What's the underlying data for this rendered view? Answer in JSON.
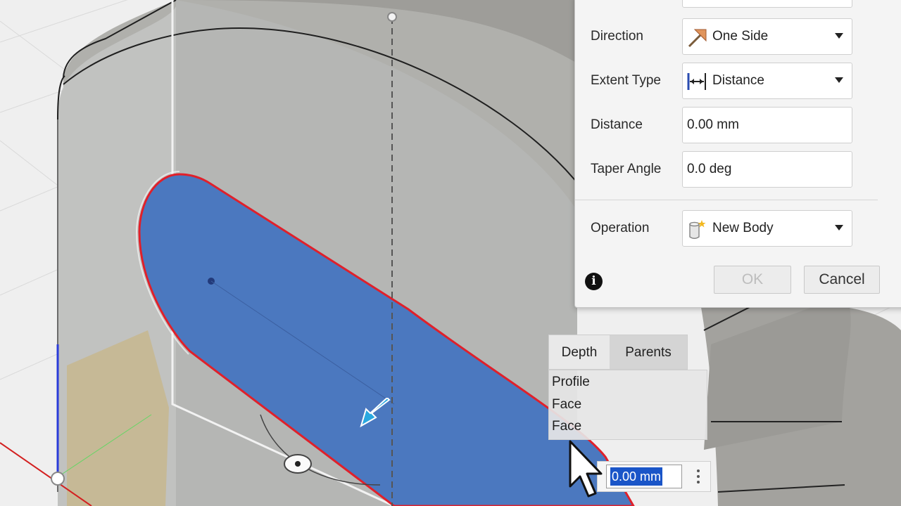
{
  "dialog": {
    "rows": [
      {
        "label": "Direction",
        "value": "One Side",
        "icon": "one-side-direction-icon",
        "dropdown": true
      },
      {
        "label": "Extent Type",
        "value": "Distance",
        "icon": "distance-extent-icon",
        "dropdown": true
      },
      {
        "label": "Distance",
        "value": "0.00 mm"
      },
      {
        "label": "Taper Angle",
        "value": "0.0 deg"
      },
      {
        "label": "Operation",
        "value": "New Body",
        "icon": "new-body-icon",
        "dropdown": true
      }
    ],
    "ok_label": "OK",
    "cancel_label": "Cancel",
    "info_icon": "info-icon"
  },
  "selection_popup": {
    "tabs": [
      "Depth",
      "Parents"
    ],
    "items": [
      "Profile",
      "Face",
      "Face"
    ]
  },
  "inline_input": {
    "value": "0.00 mm"
  },
  "colors": {
    "selected_face": "#4b78bf",
    "profile_outline": "#e0202a",
    "body_gray": "#a6a6a2",
    "accent_arrow": "#29a8e0"
  }
}
